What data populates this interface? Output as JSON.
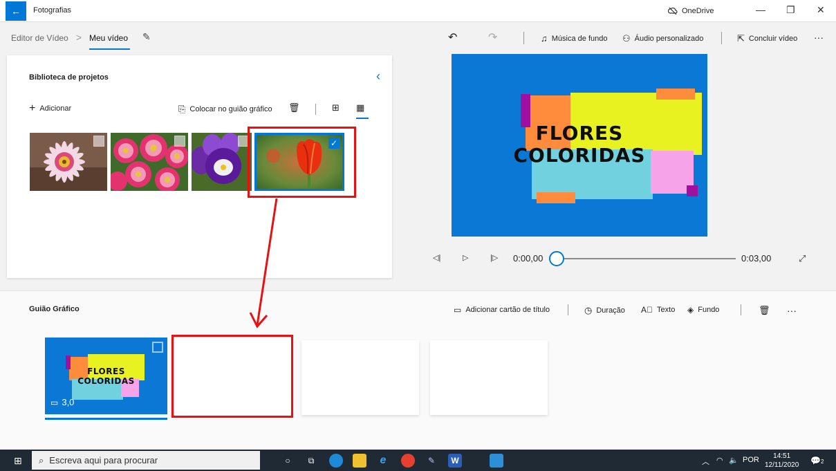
{
  "window": {
    "title": "Fotografias",
    "onedrive_label": "OneDrive",
    "controls": {
      "minimize": "—",
      "restore": "❐",
      "close": "✕"
    }
  },
  "breadcrumb": {
    "root": "Editor de Vídeo",
    "separator": ">",
    "current": "Meu vídeo"
  },
  "toolbar": {
    "undo": "↶",
    "redo": "↷",
    "background_music": "Música de fundo",
    "custom_audio": "Áudio personalizado",
    "finish_video": "Concluir vídeo",
    "more": "···"
  },
  "library": {
    "title": "Biblioteca de projetos",
    "add_label": "Adicionar",
    "place_in_storyboard": "Colocar no guião gráfico",
    "thumbnails": [
      {
        "subject": "pink-white daisy",
        "selected": false
      },
      {
        "subject": "pink gerbera bouquet",
        "selected": false
      },
      {
        "subject": "purple pansy",
        "selected": false
      },
      {
        "subject": "red tulip",
        "selected": true
      }
    ]
  },
  "preview": {
    "line1": "FLORES",
    "line2": "COLORIDAS",
    "time_current": "0:00,00",
    "time_total": "0:03,00",
    "progress": 0
  },
  "storyboard": {
    "title": "Guião Gráfico",
    "add_title_card": "Adicionar cartão de título",
    "duration": "Duração",
    "text": "Texto",
    "background": "Fundo",
    "more": "···",
    "clip": {
      "line1": "FLORES",
      "line2": "COLORIDAS",
      "duration": "3,0"
    }
  },
  "taskbar": {
    "search_placeholder": "Escreva aqui para procurar",
    "language": "POR",
    "time": "14:51",
    "date": "12/11/2020",
    "notifications": "2"
  },
  "colors": {
    "accent": "#0078d7",
    "preview_bg": "#0a78d4",
    "highlight": "#e81010",
    "title_yellow": "#e8f221",
    "title_orange": "#ff8b3d",
    "title_cyan": "#71d1df",
    "title_pink": "#f6a3e9",
    "title_purple": "#a010a0"
  }
}
